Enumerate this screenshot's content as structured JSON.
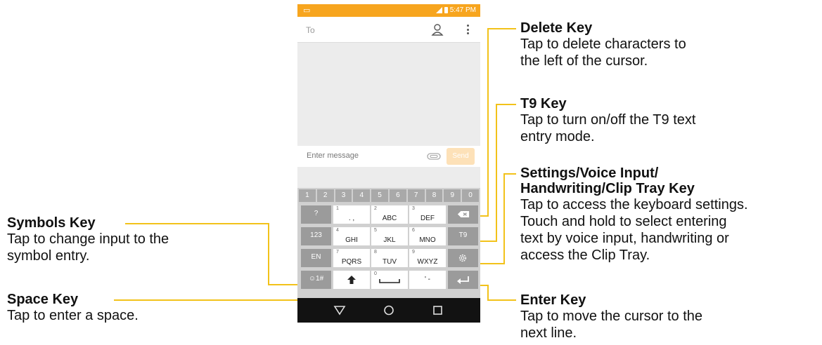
{
  "phone": {
    "status_time": "5:47 PM",
    "to_placeholder": "To",
    "compose_placeholder": "Enter message",
    "send_label": "Send",
    "number_row": [
      "1",
      "2",
      "3",
      "4",
      "5",
      "6",
      "7",
      "8",
      "9",
      "0"
    ],
    "keys": {
      "symbol_q": "?",
      "k1": {
        "n": "1",
        "l": ". ,"
      },
      "k2": {
        "n": "2",
        "l": "ABC"
      },
      "k3": {
        "n": "3",
        "l": "DEF"
      },
      "num_mode": "123",
      "k4": {
        "n": "4",
        "l": "GHI"
      },
      "k5": {
        "n": "5",
        "l": "JKL"
      },
      "k6": {
        "n": "6",
        "l": "MNO"
      },
      "t9": "T9",
      "lang": "EN",
      "k7": {
        "n": "7",
        "l": "PQRS"
      },
      "k8": {
        "n": "8",
        "l": "TUV"
      },
      "k9": {
        "n": "9",
        "l": "WXYZ"
      },
      "symbols": "☺1#",
      "k0": {
        "n": "0"
      },
      "punct": "' -"
    }
  },
  "callouts": {
    "delete": {
      "title": "Delete Key",
      "desc": "Tap to delete characters to\nthe left of the cursor."
    },
    "t9": {
      "title": "T9 Key",
      "desc": "Tap to turn on/off the T9 text\nentry mode."
    },
    "settings": {
      "title": "Settings/Voice Input/\nHandwriting/Clip Tray Key",
      "desc": "Tap to access the keyboard settings.\nTouch and hold to select entering\ntext by voice input, handwriting or\naccess the Clip Tray."
    },
    "enter": {
      "title": "Enter Key",
      "desc": "Tap to move the cursor to the\nnext line."
    },
    "symbols": {
      "title": "Symbols Key",
      "desc": "Tap to change input to the\nsymbol entry."
    },
    "space": {
      "title": "Space Key",
      "desc": "Tap to enter a space."
    }
  },
  "colors": {
    "status_bar": "#f7a51e",
    "callout_line": "#f2c21a",
    "nav_bar": "#121212"
  }
}
